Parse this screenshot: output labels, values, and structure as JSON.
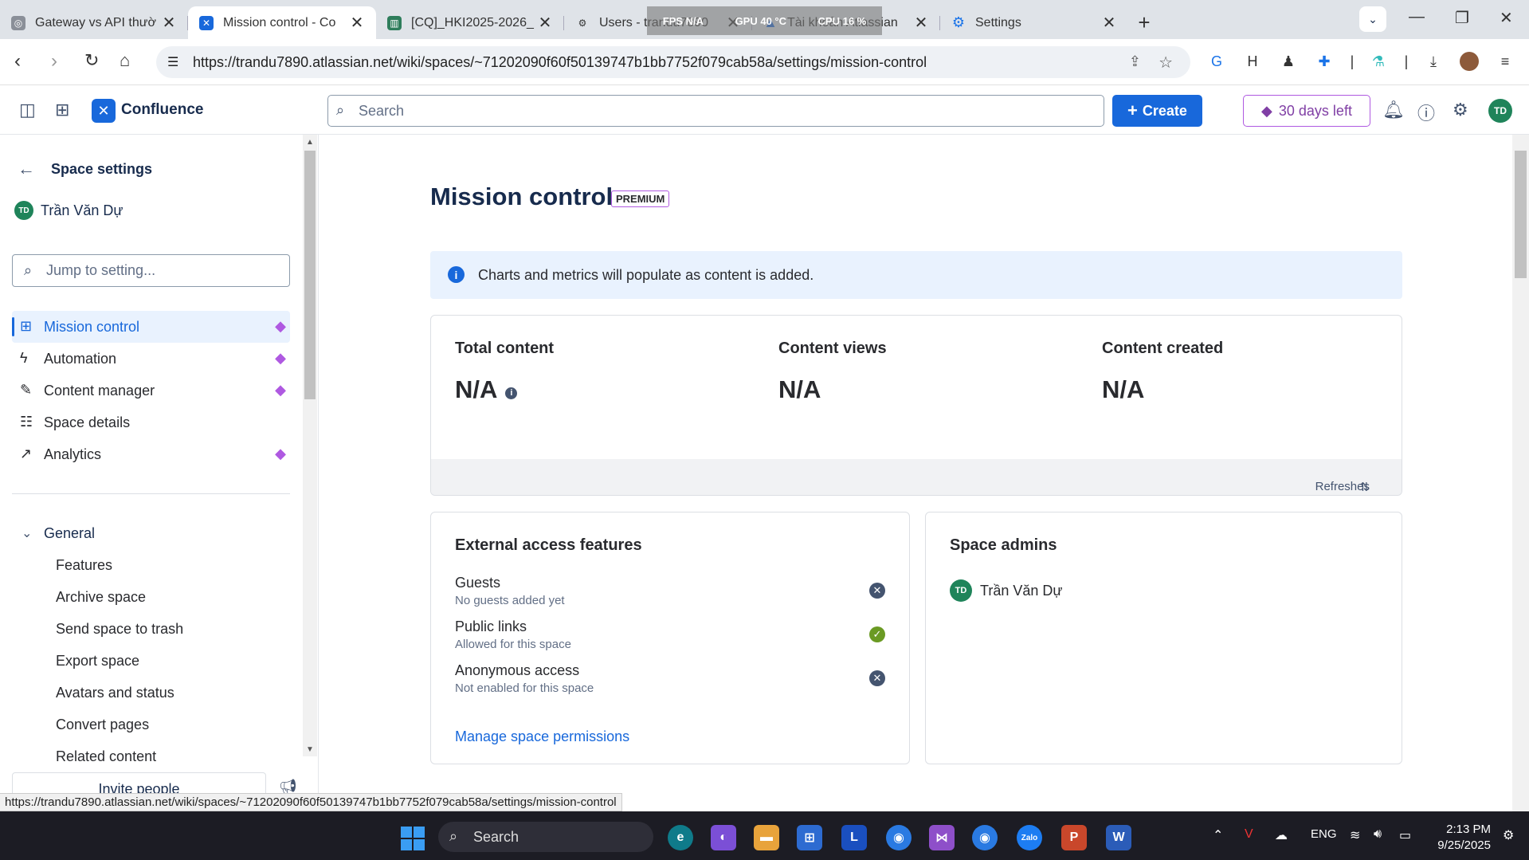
{
  "browser": {
    "tabs": [
      {
        "title": "Gateway vs API thườ",
        "favicon_color": "#8a8f98",
        "active": false
      },
      {
        "title": "Mission control - Co",
        "favicon_color": "#1868db",
        "active": true
      },
      {
        "title": "[CQ]_HKI2025-2026_",
        "favicon_color": "#2e7d5b",
        "active": false
      },
      {
        "title": "Users - trandu7890",
        "favicon_color": "#333333",
        "active": false
      },
      {
        "title": "Tài khoản Atlassian",
        "favicon_color": "#1868db",
        "active": false
      },
      {
        "title": "Settings",
        "favicon_color": "#1a73e8",
        "active": false
      }
    ],
    "perf_overlay": {
      "fps": "FPS N/A",
      "gpu": "GPU 40 °C",
      "cpu": "CPU 16 %"
    },
    "url": "https://trandu7890.atlassian.net/wiki/spaces/~71202090f60f50139747b1bb7752f079cab58a/settings/mission-control",
    "status_url": "https://trandu7890.atlassian.net/wiki/spaces/~71202090f60f50139747b1bb7752f079cab58a/settings/mission-control"
  },
  "header": {
    "product": "Confluence",
    "search_placeholder": "Search",
    "create_label": "Create",
    "trial_label": "30 days left",
    "avatar_initials": "TD"
  },
  "sidebar": {
    "title": "Space settings",
    "user_name": "Trần Văn Dự",
    "user_initials": "TD",
    "jump_placeholder": "Jump to setting...",
    "items": [
      {
        "label": "Mission control",
        "icon": "grid-icon",
        "premium": true,
        "selected": true
      },
      {
        "label": "Automation",
        "icon": "lightning-icon",
        "premium": true,
        "selected": false
      },
      {
        "label": "Content manager",
        "icon": "content-icon",
        "premium": true,
        "selected": false
      },
      {
        "label": "Space details",
        "icon": "sliders-icon",
        "premium": false,
        "selected": false
      },
      {
        "label": "Analytics",
        "icon": "chart-icon",
        "premium": true,
        "selected": false
      }
    ],
    "general_label": "General",
    "general_items": [
      "Features",
      "Archive space",
      "Send space to trash",
      "Export space",
      "Avatars and status",
      "Convert pages",
      "Related content"
    ],
    "footer_label": "Invite people"
  },
  "main": {
    "title": "Mission control",
    "badge": "PREMIUM",
    "info": "Charts and metrics will populate as content is added.",
    "metrics": [
      {
        "label": "Total content",
        "value": "N/A",
        "has_info": true
      },
      {
        "label": "Content views",
        "value": "N/A",
        "has_info": false
      },
      {
        "label": "Content created",
        "value": "N/A",
        "has_info": false
      }
    ],
    "refresh_note": "Refreshes daily",
    "external": {
      "title": "External access features",
      "features": [
        {
          "name": "Guests",
          "desc": "No guests added yet",
          "enabled": false
        },
        {
          "name": "Public links",
          "desc": "Allowed for this space",
          "enabled": true
        },
        {
          "name": "Anonymous access",
          "desc": "Not enabled for this space",
          "enabled": false
        }
      ],
      "link": "Manage space permissions"
    },
    "admins": {
      "title": "Space admins",
      "list": [
        {
          "name": "Trần Văn Dự",
          "initials": "TD"
        }
      ]
    }
  },
  "taskbar": {
    "search_label": "Search",
    "lang": "ENG",
    "time": "2:13 PM",
    "date": "9/25/2025"
  }
}
